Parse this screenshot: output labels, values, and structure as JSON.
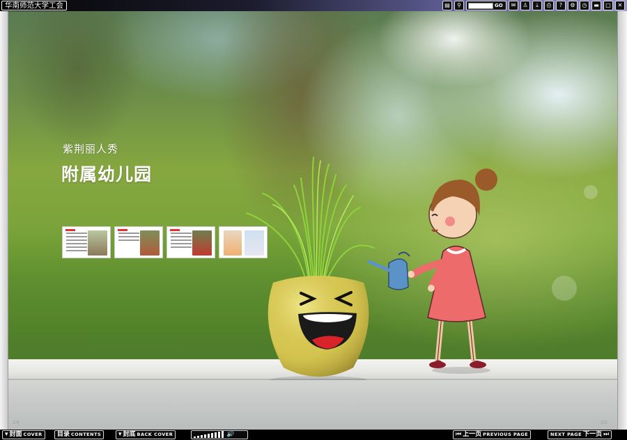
{
  "app": {
    "title": "华南师范大学工会"
  },
  "toolbar": {
    "icons": [
      "thumbnails-icon",
      "zoom-icon",
      "page-input",
      "comment-icon",
      "user-icon",
      "download-icon",
      "print-icon",
      "help-icon",
      "settings-icon",
      "timer-icon",
      "minimize-icon",
      "maximize-icon",
      "close-icon"
    ],
    "go_label": "GO"
  },
  "page": {
    "subtitle": "紫荆丽人秀",
    "title": "附属幼儿园",
    "left_page_number": "29",
    "right_page_number": "30"
  },
  "thumbnails": [
    {
      "name": "thumbnail-1"
    },
    {
      "name": "thumbnail-2"
    },
    {
      "name": "thumbnail-3"
    },
    {
      "name": "thumbnail-4"
    }
  ],
  "nav": {
    "cover_cn": "封面",
    "cover_en": "COVER",
    "contents_cn": "目录",
    "contents_en": "CONTENTS",
    "back_cover_cn": "封底",
    "back_cover_en": "BACK COVER",
    "prev_cn": "上一页",
    "prev_en": "PREVIOUS PAGE",
    "next_en": "NEXT PAGE",
    "next_cn": "下一页"
  },
  "volume": {
    "level": 0.8
  },
  "colors": {
    "top_gradient_end": "#9a96cc",
    "bar_bg": "#000000",
    "title_text": "#ffffff"
  }
}
